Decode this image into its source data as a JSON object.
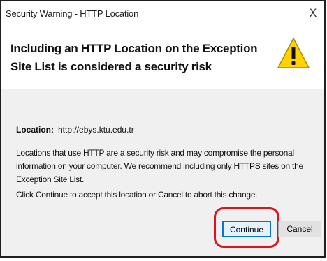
{
  "window": {
    "title": "Security Warning - HTTP Location",
    "close_glyph": "X"
  },
  "header": {
    "message": "Including an HTTP Location on the Exception Site List is considered a security risk",
    "icon": "warning-icon"
  },
  "content": {
    "location_label": "Location:",
    "location_value": "http://ebys.ktu.edu.tr",
    "paragraph1": "Locations that use HTTP are a security risk and may compromise the personal information on your computer.  We recommend including only HTTPS sites on the Exception Site List.",
    "paragraph2": "Click Continue to accept this location or Cancel to abort this change."
  },
  "buttons": {
    "continue_label": "Continue",
    "cancel_label": "Cancel"
  },
  "colors": {
    "content_bg": "#f0f0f0",
    "highlight": "#e4101b",
    "default_button_border": "#0078d7",
    "warning_fill": "#ffd200"
  }
}
